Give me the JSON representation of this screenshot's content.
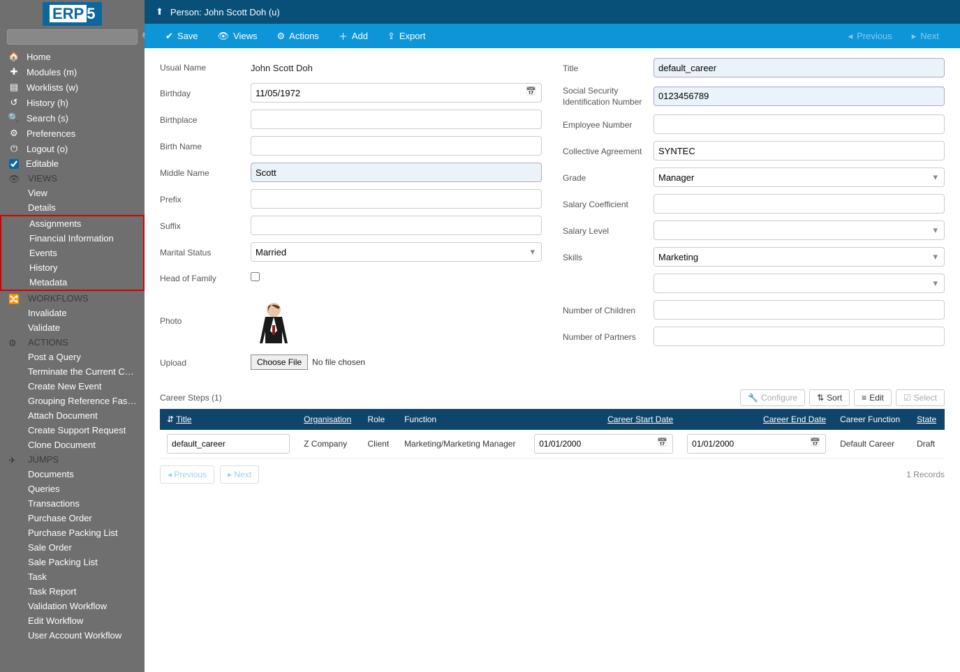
{
  "logo": {
    "prefix": "ERP",
    "suffix": "5"
  },
  "sidebar": {
    "search_placeholder": "",
    "main": [
      {
        "icon": "🏠",
        "label": "Home"
      },
      {
        "icon": "✚",
        "label": "Modules (m)"
      },
      {
        "icon": "▤",
        "label": "Worklists (w)"
      },
      {
        "icon": "↺",
        "label": "History (h)"
      },
      {
        "icon": "🔍",
        "label": "Search (s)"
      },
      {
        "icon": "⚙",
        "label": "Preferences"
      },
      {
        "icon": "⏻",
        "label": "Logout (o)"
      }
    ],
    "editable_label": "Editable",
    "editable_checked": true,
    "views_header": "VIEWS",
    "views_pre": [
      {
        "label": "View"
      },
      {
        "label": "Details"
      }
    ],
    "views_boxed": [
      {
        "label": "Assignments"
      },
      {
        "label": "Financial Information"
      },
      {
        "label": "Events"
      },
      {
        "label": "History"
      },
      {
        "label": "Metadata"
      }
    ],
    "workflows_header": "WORKFLOWS",
    "workflows": [
      {
        "label": "Invalidate"
      },
      {
        "label": "Validate"
      }
    ],
    "actions_header": "ACTIONS",
    "actions": [
      {
        "label": "Post a Query"
      },
      {
        "label": "Terminate the Current Career…"
      },
      {
        "label": "Create New Event"
      },
      {
        "label": "Grouping Reference Fast Input"
      },
      {
        "label": "Attach Document"
      },
      {
        "label": "Create Support Request"
      },
      {
        "label": "Clone Document"
      }
    ],
    "jumps_header": "JUMPS",
    "jumps": [
      {
        "label": "Documents"
      },
      {
        "label": "Queries"
      },
      {
        "label": "Transactions"
      },
      {
        "label": "Purchase Order"
      },
      {
        "label": "Purchase Packing List"
      },
      {
        "label": "Sale Order"
      },
      {
        "label": "Sale Packing List"
      },
      {
        "label": "Task"
      },
      {
        "label": "Task Report"
      },
      {
        "label": "Validation Workflow"
      },
      {
        "label": "Edit Workflow"
      },
      {
        "label": "User Account Workflow"
      }
    ]
  },
  "header": {
    "breadcrumb": "Person: John Scott Doh (u)"
  },
  "toolbar": {
    "save": "Save",
    "views": "Views",
    "actions": "Actions",
    "add": "Add",
    "export": "Export",
    "previous": "Previous",
    "next": "Next"
  },
  "labels": {
    "usual_name": "Usual Name",
    "birthday": "Birthday",
    "birthplace": "Birthplace",
    "birth_name": "Birth Name",
    "middle_name": "Middle Name",
    "prefix": "Prefix",
    "suffix": "Suffix",
    "marital_status": "Marital Status",
    "head_of_family": "Head of Family",
    "photo": "Photo",
    "upload": "Upload",
    "title": "Title",
    "ssn": "Social Security Identification Number",
    "employee_number": "Employee Number",
    "collective_agreement": "Collective Agreement",
    "grade": "Grade",
    "salary_coefficient": "Salary Coefficient",
    "salary_level": "Salary Level",
    "skills": "Skills",
    "num_children": "Number of Children",
    "num_partners": "Number of Partners"
  },
  "form": {
    "usual_name": "John Scott Doh",
    "birthday": "11/05/1972",
    "birthplace": "",
    "birth_name": "",
    "middle_name": "Scott",
    "prefix": "",
    "suffix": "",
    "marital_status": "Married",
    "head_of_family": false,
    "upload_button": "Choose File",
    "upload_text": "No file chosen",
    "title": "default_career",
    "ssn": "0123456789",
    "employee_number": "",
    "collective_agreement": "SYNTEC",
    "grade": "Manager",
    "salary_coefficient": "",
    "salary_level": "",
    "skills": "Marketing",
    "skills2": "",
    "num_children": "",
    "num_partners": ""
  },
  "table": {
    "title": "Career Steps (1)",
    "tools": {
      "configure": "Configure",
      "sort": "Sort",
      "edit": "Edit",
      "select": "Select"
    },
    "headers": {
      "title": "Title",
      "organisation": "Organisation",
      "role": "Role",
      "function": "Function",
      "start": "Career Start Date",
      "end": "Career End Date",
      "career_function": "Career Function",
      "state": "State"
    },
    "rows": [
      {
        "title": "default_career",
        "organisation": "Z Company",
        "role": "Client",
        "function": "Marketing/Marketing Manager",
        "start": "01/01/2000",
        "end": "01/01/2000",
        "career_function": "Default Career",
        "state": "Draft"
      }
    ],
    "pager": {
      "previous": "Previous",
      "next": "Next",
      "records": "1 Records"
    }
  }
}
